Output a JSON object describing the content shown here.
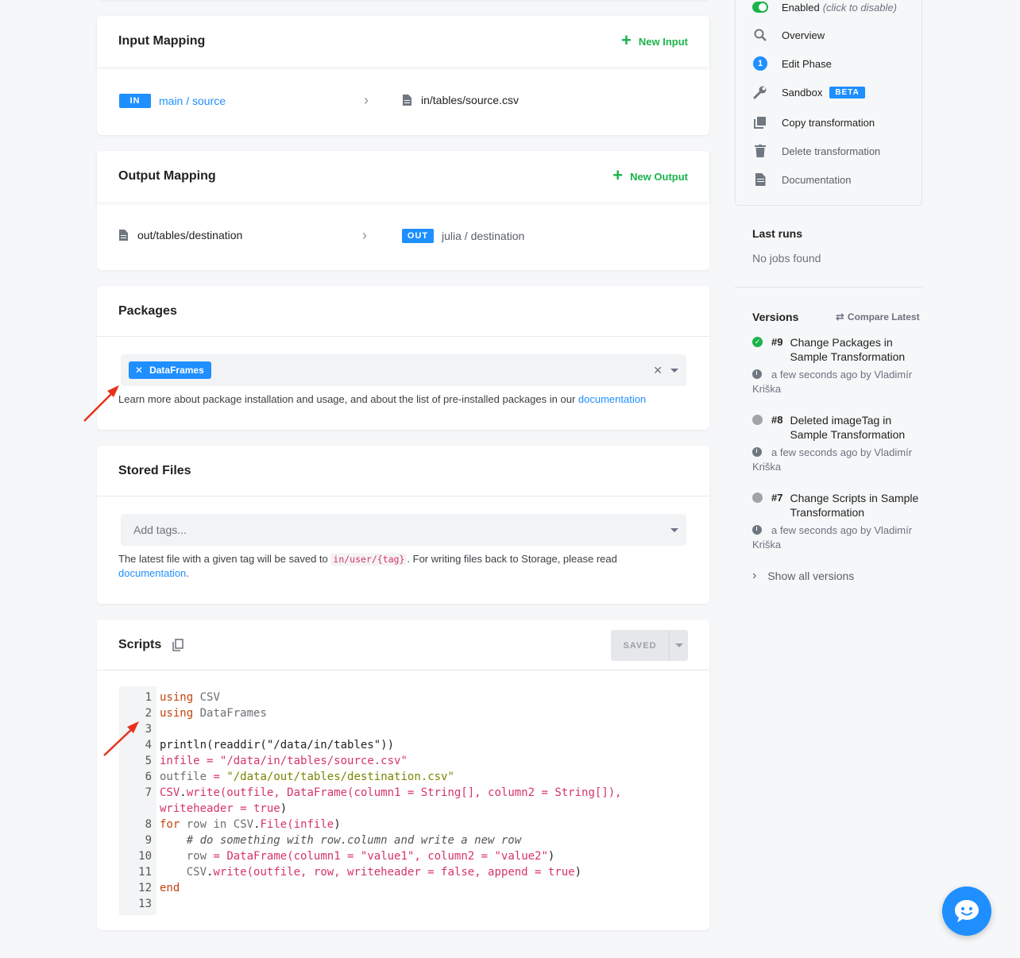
{
  "input_mapping": {
    "title": "Input Mapping",
    "new_label": "New Input",
    "badge": "IN",
    "source": "main / source",
    "destination": "in/tables/source.csv"
  },
  "output_mapping": {
    "title": "Output Mapping",
    "new_label": "New Output",
    "source": "out/tables/destination",
    "badge": "OUT",
    "destination": "julia / destination"
  },
  "packages": {
    "title": "Packages",
    "tag": "DataFrames",
    "help_text": "Learn more about package installation and usage, and about the list of pre-installed packages in our",
    "help_link": "documentation"
  },
  "stored_files": {
    "title": "Stored Files",
    "placeholder": "Add tags...",
    "help_before": "The latest file with a given tag will be saved to",
    "help_code": "in/user/{tag}",
    "help_after": ". For writing files back to Storage, please read",
    "help_link": "documentation",
    "help_end": "."
  },
  "scripts": {
    "title": "Scripts",
    "saved_label": "SAVED",
    "line_numbers": [
      "1",
      "2",
      "3",
      "4",
      "5",
      "6",
      "7",
      "",
      "8",
      "9",
      "10",
      "11",
      "12",
      "13"
    ]
  },
  "sidebar": {
    "enabled_label": "Enabled",
    "enabled_hint": "(click to disable)",
    "overview": "Overview",
    "edit_phase": "Edit Phase",
    "edit_phase_num": "1",
    "sandbox": "Sandbox",
    "beta": "BETA",
    "copy": "Copy transformation",
    "delete": "Delete transformation",
    "documentation": "Documentation"
  },
  "last_runs": {
    "title": "Last runs",
    "empty": "No jobs found"
  },
  "versions": {
    "title": "Versions",
    "compare": "Compare Latest",
    "items": [
      {
        "num": "#9",
        "title": "Change Packages in Sample Transformation",
        "meta": "a few seconds ago by Vladimír Kriška",
        "status_color": "#1bb34a"
      },
      {
        "num": "#8",
        "title": "Deleted imageTag in Sample Transformation",
        "meta": "a few seconds ago by Vladimír Kriška",
        "status_color": "#a0a4a8"
      },
      {
        "num": "#7",
        "title": "Change Scripts in Sample Transformation",
        "meta": "a few seconds ago by Vladimír Kriška",
        "status_color": "#a0a4a8"
      }
    ],
    "show_all": "Show all versions"
  }
}
